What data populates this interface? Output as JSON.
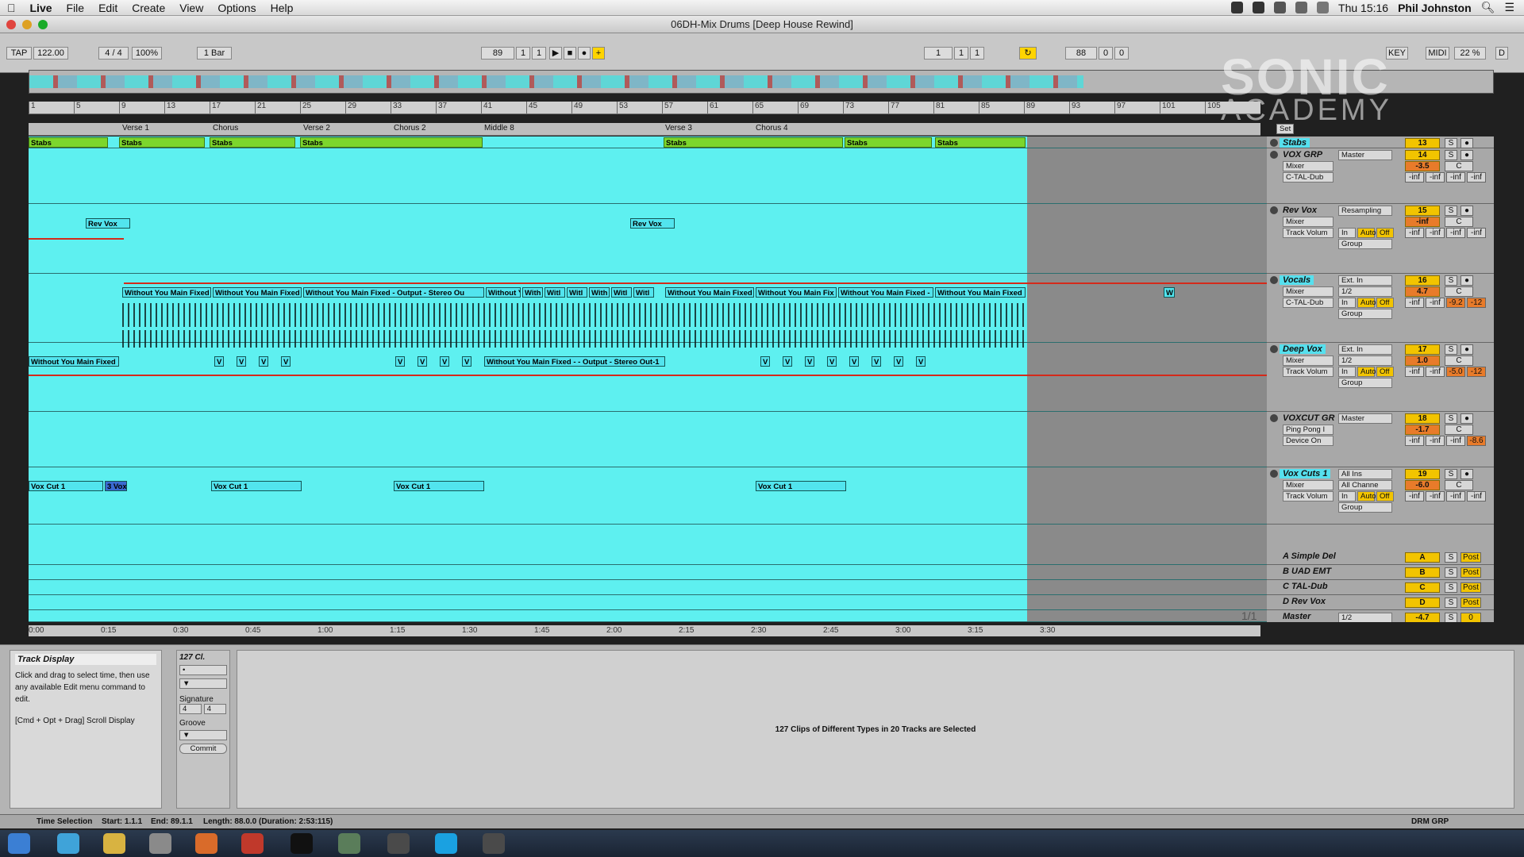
{
  "menubar": {
    "apple": "",
    "app": "Live",
    "items": [
      "File",
      "Edit",
      "Create",
      "View",
      "Options",
      "Help"
    ],
    "clock": "Thu 15:16",
    "user": "Phil Johnston"
  },
  "window": {
    "title": "06DH-Mix Drums  [Deep House Rewind]"
  },
  "control": {
    "tap": "TAP",
    "tempo": "122.00",
    "sig": "4 / 4",
    "zoom": "100%",
    "quant": "1 Bar",
    "pos_bar": "89",
    "pos_beat": "1",
    "pos_sixteenth": "1",
    "loop_start": "1",
    "loop_beat": "1",
    "loop_sixteenth": "1",
    "loop_len": "88",
    "loop_len_b": "0",
    "loop_len_c": "0",
    "key": "KEY",
    "midi": "MIDI",
    "cpu": "22 %",
    "d": "D"
  },
  "logo": {
    "line1": "SONIC",
    "line2": "ACADEMY"
  },
  "ruler": [
    "1",
    "5",
    "9",
    "13",
    "17",
    "21",
    "25",
    "29",
    "33",
    "37",
    "41",
    "45",
    "49",
    "53",
    "57",
    "61",
    "65",
    "69",
    "73",
    "77",
    "81",
    "85",
    "89",
    "93",
    "97",
    "101",
    "105"
  ],
  "locators": [
    "Verse 1",
    "Chorus",
    "Verse 2",
    "Chorus 2",
    "Middle 8",
    "Verse 3",
    "Chorus 4"
  ],
  "set_label": "Set",
  "lanes": {
    "stabs": [
      "Stabs",
      "Stabs",
      "Stabs",
      "Stabs",
      "Stabs",
      "Stabs",
      "Stabs",
      "Stabs"
    ],
    "revvox": [
      "Rev Vox",
      "Rev Vox"
    ],
    "vocals": [
      "Without You Main Fixed",
      "Without You Main Fixed",
      "Without You Main Fixed - Output - Stereo Ou",
      "Without Y",
      "With",
      "Witl",
      "Witl",
      "With",
      "Witl",
      "Witl",
      "Without You Main Fixed",
      "Without You Main Fix",
      "Without You Main Fixed -",
      "Without You Main Fixed",
      "W"
    ],
    "deepvox": [
      "Without You Main Fixed",
      "V",
      "V",
      "V",
      "V",
      "V",
      "V",
      "V",
      "V",
      "Without You Main Fixed - - Output - Stereo Out-1",
      "V",
      "V",
      "V",
      "V",
      "V",
      "V",
      "V",
      "V"
    ],
    "voxcuts": [
      "Vox Cut 1",
      "3 Vox",
      "Vox Cut 1",
      "Vox Cut 1",
      "Vox Cut 1"
    ]
  },
  "mixer": [
    {
      "name": "Stabs",
      "num": "13",
      "s": "S",
      "sel": true
    },
    {
      "name": "VOX GRP",
      "num": "14",
      "route": "Master",
      "dev1": "Mixer",
      "dev2": "C-TAL-Dub",
      "vol": "-3.5",
      "pan": "C",
      "sends": [
        "-inf",
        "-inf",
        "-inf",
        "-inf"
      ]
    },
    {
      "name": "Rev Vox",
      "num": "15",
      "route": "Resampling",
      "dev1": "Mixer",
      "dev2": "Track Volum",
      "vol": "-inf",
      "pan": "C",
      "mon": [
        "In",
        "Auto",
        "Off"
      ],
      "group": "Group",
      "sends": [
        "-inf",
        "-inf",
        "-inf",
        "-inf"
      ]
    },
    {
      "name": "Vocals",
      "num": "16",
      "route": "Ext. In",
      "ch": "1/2",
      "dev1": "Mixer",
      "dev2": "C-TAL-Dub",
      "vol": "4.7",
      "pan": "C",
      "mon": [
        "In",
        "Auto",
        "Off"
      ],
      "group": "Group",
      "sends": [
        "-inf",
        "-inf",
        "-9.2",
        "-12"
      ],
      "sel": true
    },
    {
      "name": "Deep Vox",
      "num": "17",
      "route": "Ext. In",
      "ch": "1/2",
      "dev1": "Mixer",
      "dev2": "Track Volum",
      "vol": "1.0",
      "pan": "C",
      "mon": [
        "In",
        "Auto",
        "Off"
      ],
      "group": "Group",
      "sends": [
        "-inf",
        "-inf",
        "-5.0",
        "-12"
      ],
      "sel": true
    },
    {
      "name": "VOXCUT GR",
      "num": "18",
      "route": "Master",
      "dev1": "Ping Pong I",
      "dev2": "Device On",
      "vol": "-1.7",
      "pan": "C",
      "sends": [
        "-inf",
        "-inf",
        "-inf",
        "-8.6"
      ]
    },
    {
      "name": "Vox Cuts 1",
      "num": "19",
      "route": "All Ins",
      "ch": "All Channe",
      "dev1": "Mixer",
      "dev2": "Track Volum",
      "vol": "-6.0",
      "pan": "C",
      "mon": [
        "In",
        "Auto",
        "Off"
      ],
      "group": "Group",
      "sends": [
        "-inf",
        "-inf",
        "-inf",
        "-inf"
      ],
      "sel": true
    }
  ],
  "returns": [
    {
      "name": "A Simple Del",
      "letter": "A",
      "post": "Post"
    },
    {
      "name": "B UAD EMT",
      "letter": "B",
      "post": "Post"
    },
    {
      "name": "C TAL-Dub",
      "letter": "C",
      "post": "Post"
    },
    {
      "name": "D Rev Vox",
      "letter": "D",
      "post": "Post"
    },
    {
      "name": "Master",
      "letter": "-4.7",
      "post": "0",
      "ch": "1/2"
    }
  ],
  "page_ind": "1/1",
  "timeruler": [
    "0:00",
    "0:15",
    "0:30",
    "0:45",
    "1:00",
    "1:15",
    "1:30",
    "1:45",
    "2:00",
    "2:15",
    "2:30",
    "2:45",
    "3:00",
    "3:15",
    "3:30"
  ],
  "info": {
    "title": "Track Display",
    "body": "Click and drag to select time, then use any available Edit menu command to edit.",
    "shortcut": "[Cmd + Opt + Drag] Scroll Display"
  },
  "clip": {
    "name": "127 Cl.",
    "sig_label": "Signature",
    "sig_num": "4",
    "sig_den": "4",
    "groove": "Groove",
    "commit": "Commit"
  },
  "view_msg": "127 Clips of Different Types in 20 Tracks are Selected",
  "status": {
    "label": "Time Selection",
    "start": "Start: 1.1.1",
    "end": "End: 89.1.1",
    "length": "Length: 88.0.0 (Duration: 2:53:115)",
    "right": "DRM GRP"
  }
}
